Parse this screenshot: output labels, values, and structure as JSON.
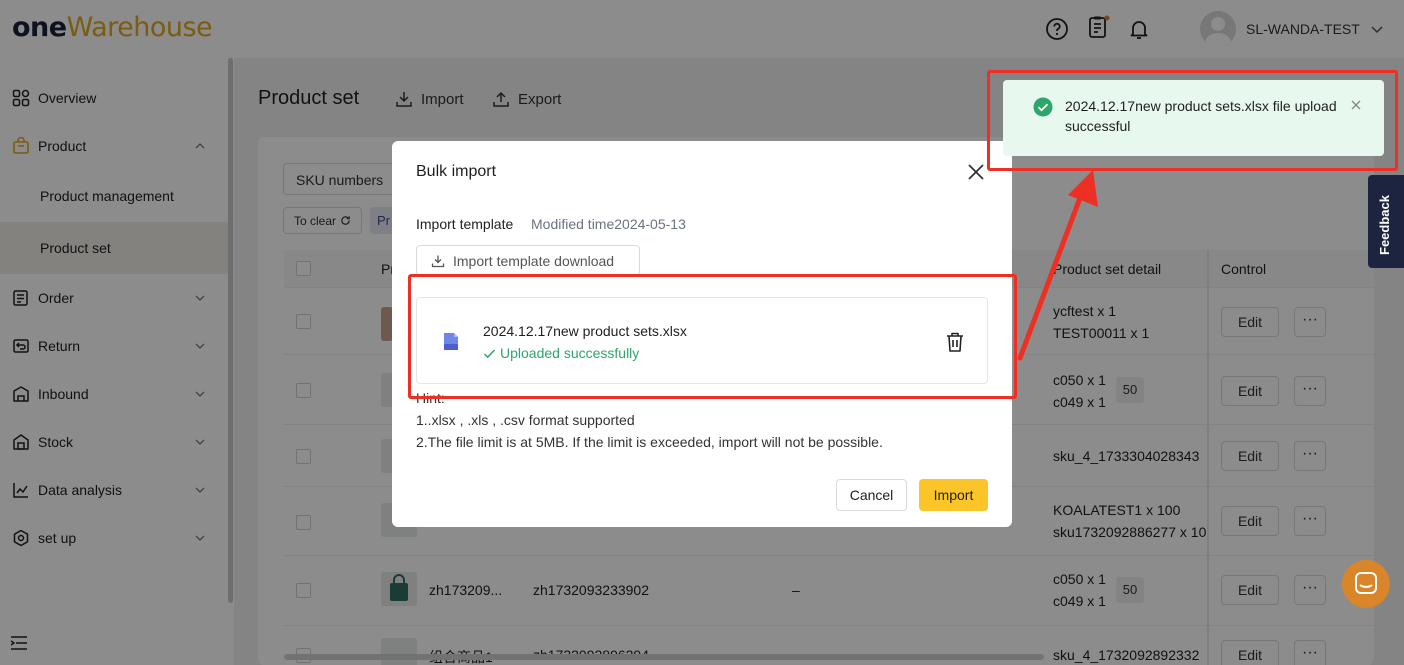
{
  "header": {
    "logo_one": "one",
    "logo_warehouse": "Warehouse",
    "user_name": "SL-WANDA-TEST"
  },
  "sidebar": {
    "items": [
      {
        "label": "Overview",
        "icon": "grid-icon"
      },
      {
        "label": "Product",
        "icon": "bag-icon"
      },
      {
        "label": "Order",
        "icon": "order-icon"
      },
      {
        "label": "Return",
        "icon": "return-icon"
      },
      {
        "label": "Inbound",
        "icon": "inbound-icon"
      },
      {
        "label": "Stock",
        "icon": "stock-icon"
      },
      {
        "label": "Data analysis",
        "icon": "chart-icon"
      },
      {
        "label": "set up",
        "icon": "gear-icon"
      }
    ],
    "sub_items": [
      "Product management",
      "Product set"
    ]
  },
  "page": {
    "title": "Product set",
    "import_label": "Import",
    "export_label": "Export",
    "filter_sku": "SKU numbers",
    "clear_label": "To clear",
    "tag_label": "Pr",
    "columns": {
      "product": "Pr",
      "detail": "Product set detail",
      "control": "Control"
    },
    "rows": [
      {
        "name": "",
        "code": "",
        "dash": "",
        "detail": [
          "ycftest x 1",
          "TEST00011 x 1"
        ],
        "badge": ""
      },
      {
        "name": "",
        "code": "",
        "dash": "",
        "detail": [
          "c050 x 1",
          "c049 x 1"
        ],
        "badge": "50"
      },
      {
        "name": "",
        "code": "",
        "dash": "",
        "detail": [
          "sku_4_1733304028343"
        ],
        "badge": ""
      },
      {
        "name": "",
        "code": "",
        "dash": "",
        "detail": [
          "KOALATEST1 x 100",
          "sku1732092886277 x 10"
        ],
        "badge": ""
      },
      {
        "name": "zh173209...",
        "code": "zh1732093233902",
        "dash": "–",
        "detail": [
          "c050 x 1",
          "c049 x 1"
        ],
        "badge": "50"
      },
      {
        "name": "组合商品1",
        "code": "zh1732092896294",
        "dash": "",
        "detail": [
          "sku_4_1732092892332"
        ],
        "badge": ""
      }
    ],
    "edit_label": "Edit",
    "more_label": "···"
  },
  "modal": {
    "title": "Bulk import",
    "template_label": "Import template",
    "template_time": "Modified time2024-05-13",
    "template_download": "Import template download",
    "file_name": "2024.12.17new product sets.xlsx",
    "file_status": "Uploaded successfully",
    "hint_title": "Hint:",
    "hint_1": "1..xlsx , .xls , .csv format supported",
    "hint_2": "2.The file limit is at 5MB. If the limit is exceeded, import will not be possible.",
    "cancel_label": "Cancel",
    "import_label": "Import"
  },
  "toast": {
    "message": "2024.12.17new product sets.xlsx file upload successful"
  },
  "feedback_label": "Feedback",
  "colors": {
    "accent": "#fbc52a",
    "success": "#2ea66b",
    "annotation": "#ee2f24",
    "toast_bg": "#e7f8ef"
  }
}
